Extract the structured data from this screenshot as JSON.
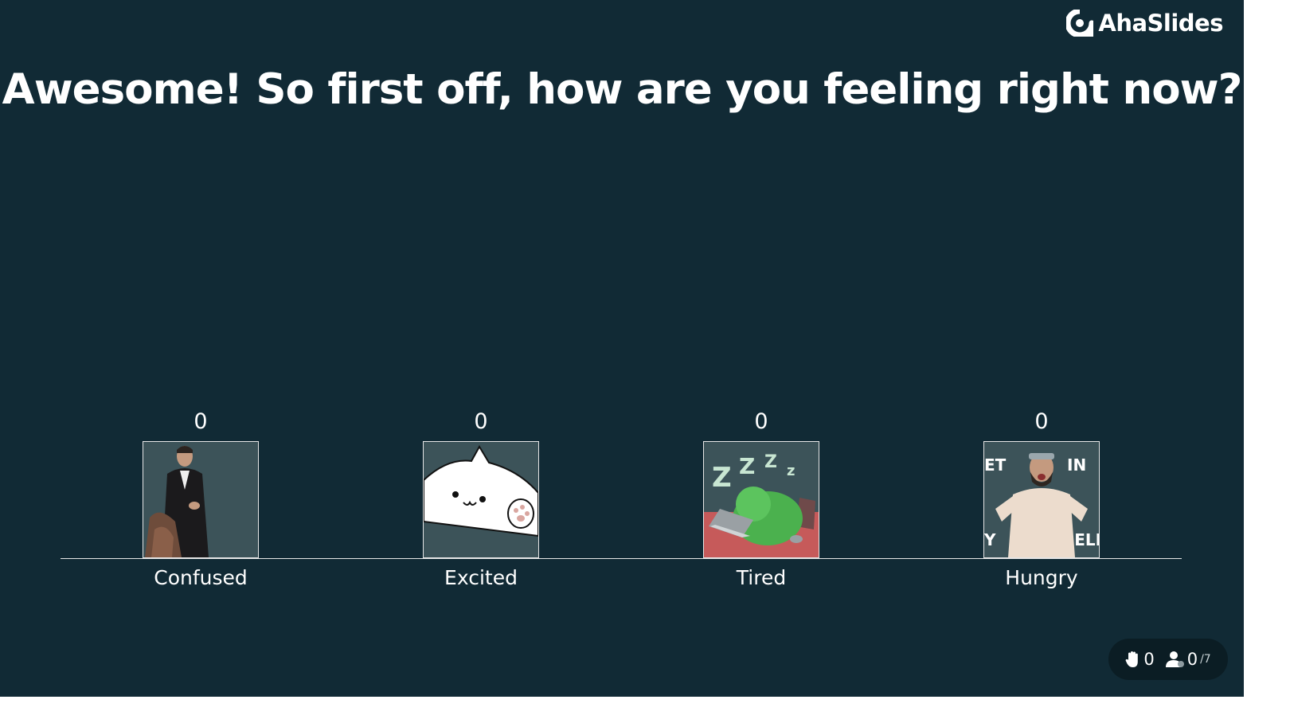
{
  "brand": {
    "name": "AhaSlides",
    "logo_icon": "ahaslides-logo-icon"
  },
  "slide": {
    "title": "Awesome! So first off, how are you feeling right now?",
    "background": "#112a35"
  },
  "chart_data": {
    "type": "bar",
    "title": "",
    "categories": [
      "Confused",
      "Excited",
      "Tired",
      "Hungry"
    ],
    "values": [
      0,
      0,
      0,
      0
    ],
    "xlabel": "",
    "ylabel": "",
    "grid": false,
    "legend": "none"
  },
  "options": [
    {
      "label": "Confused",
      "count": "0",
      "image": "confused-man-gif"
    },
    {
      "label": "Excited",
      "count": "0",
      "image": "white-cat-gif"
    },
    {
      "label": "Tired",
      "count": "0",
      "image": "sleepy-green-bear-laptop-gif"
    },
    {
      "label": "Hungry",
      "count": "0",
      "image": "bearded-man-belly-gif"
    }
  ],
  "status": {
    "hands_icon": "raised-hand-icon",
    "hands_count": "0",
    "participants_icon": "participants-icon",
    "participants_count": "0",
    "participants_total": "/7"
  }
}
